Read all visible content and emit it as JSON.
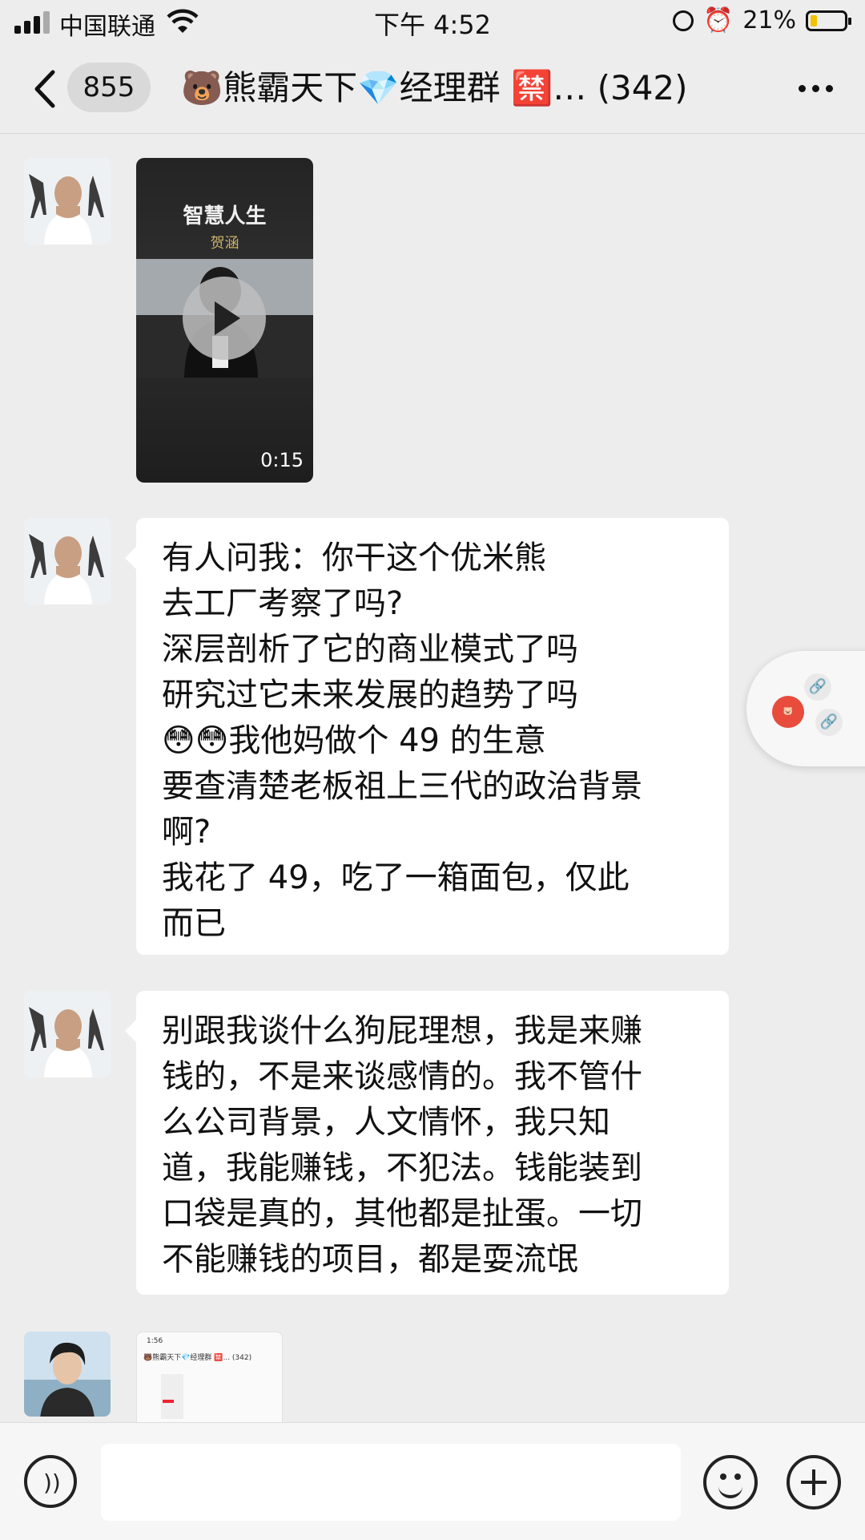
{
  "status_bar": {
    "carrier": "中国联通",
    "time": "下午 4:52",
    "battery": "21%",
    "battery_level": 0.21,
    "icons": [
      "signal-icon",
      "wifi-icon",
      "rotation-lock-icon",
      "alarm-icon",
      "battery-charging-icon"
    ]
  },
  "nav": {
    "unread_count": "855",
    "title": "🐻熊霸天下💎经理群 🈲… (342)",
    "icons": [
      "back-chevron-icon",
      "more-dots-icon"
    ]
  },
  "messages": [
    {
      "type": "video",
      "video_title": "智慧人生",
      "video_subtitle": "贺涵",
      "duration": "0:15"
    },
    {
      "type": "text",
      "text": "有人问我：你干这个优米熊\n去工厂考察了吗?\n深层剖析了它的商业模式了吗\n研究过它未来发展的趋势了吗\n😳😳我他妈做个 49 的生意\n要查清楚老板祖上三代的政治背景\n啊?\n我花了 49，吃了一箱面包，仅此\n而已"
    },
    {
      "type": "text",
      "text": "别跟我谈什么狗屁理想，我是来赚\n钱的，不是来谈感情的。我不管什\n么公司背景，人文情怀，我只知\n道，我能赚钱，不犯法。钱能装到\n口袋是真的，其他都是扯蛋。一切\n不能赚钱的项目，都是耍流氓"
    },
    {
      "type": "image",
      "preview_time": "1:56",
      "preview_title": "🐻熊霸天下💎经理群 🈲... (342)"
    }
  ],
  "floating_window": {
    "icons": [
      "mini-program-avatar-icon",
      "link-icon",
      "link-icon"
    ]
  },
  "input_bar": {
    "placeholder": "",
    "icons": [
      "voice-icon",
      "emoji-icon",
      "plus-icon"
    ]
  }
}
